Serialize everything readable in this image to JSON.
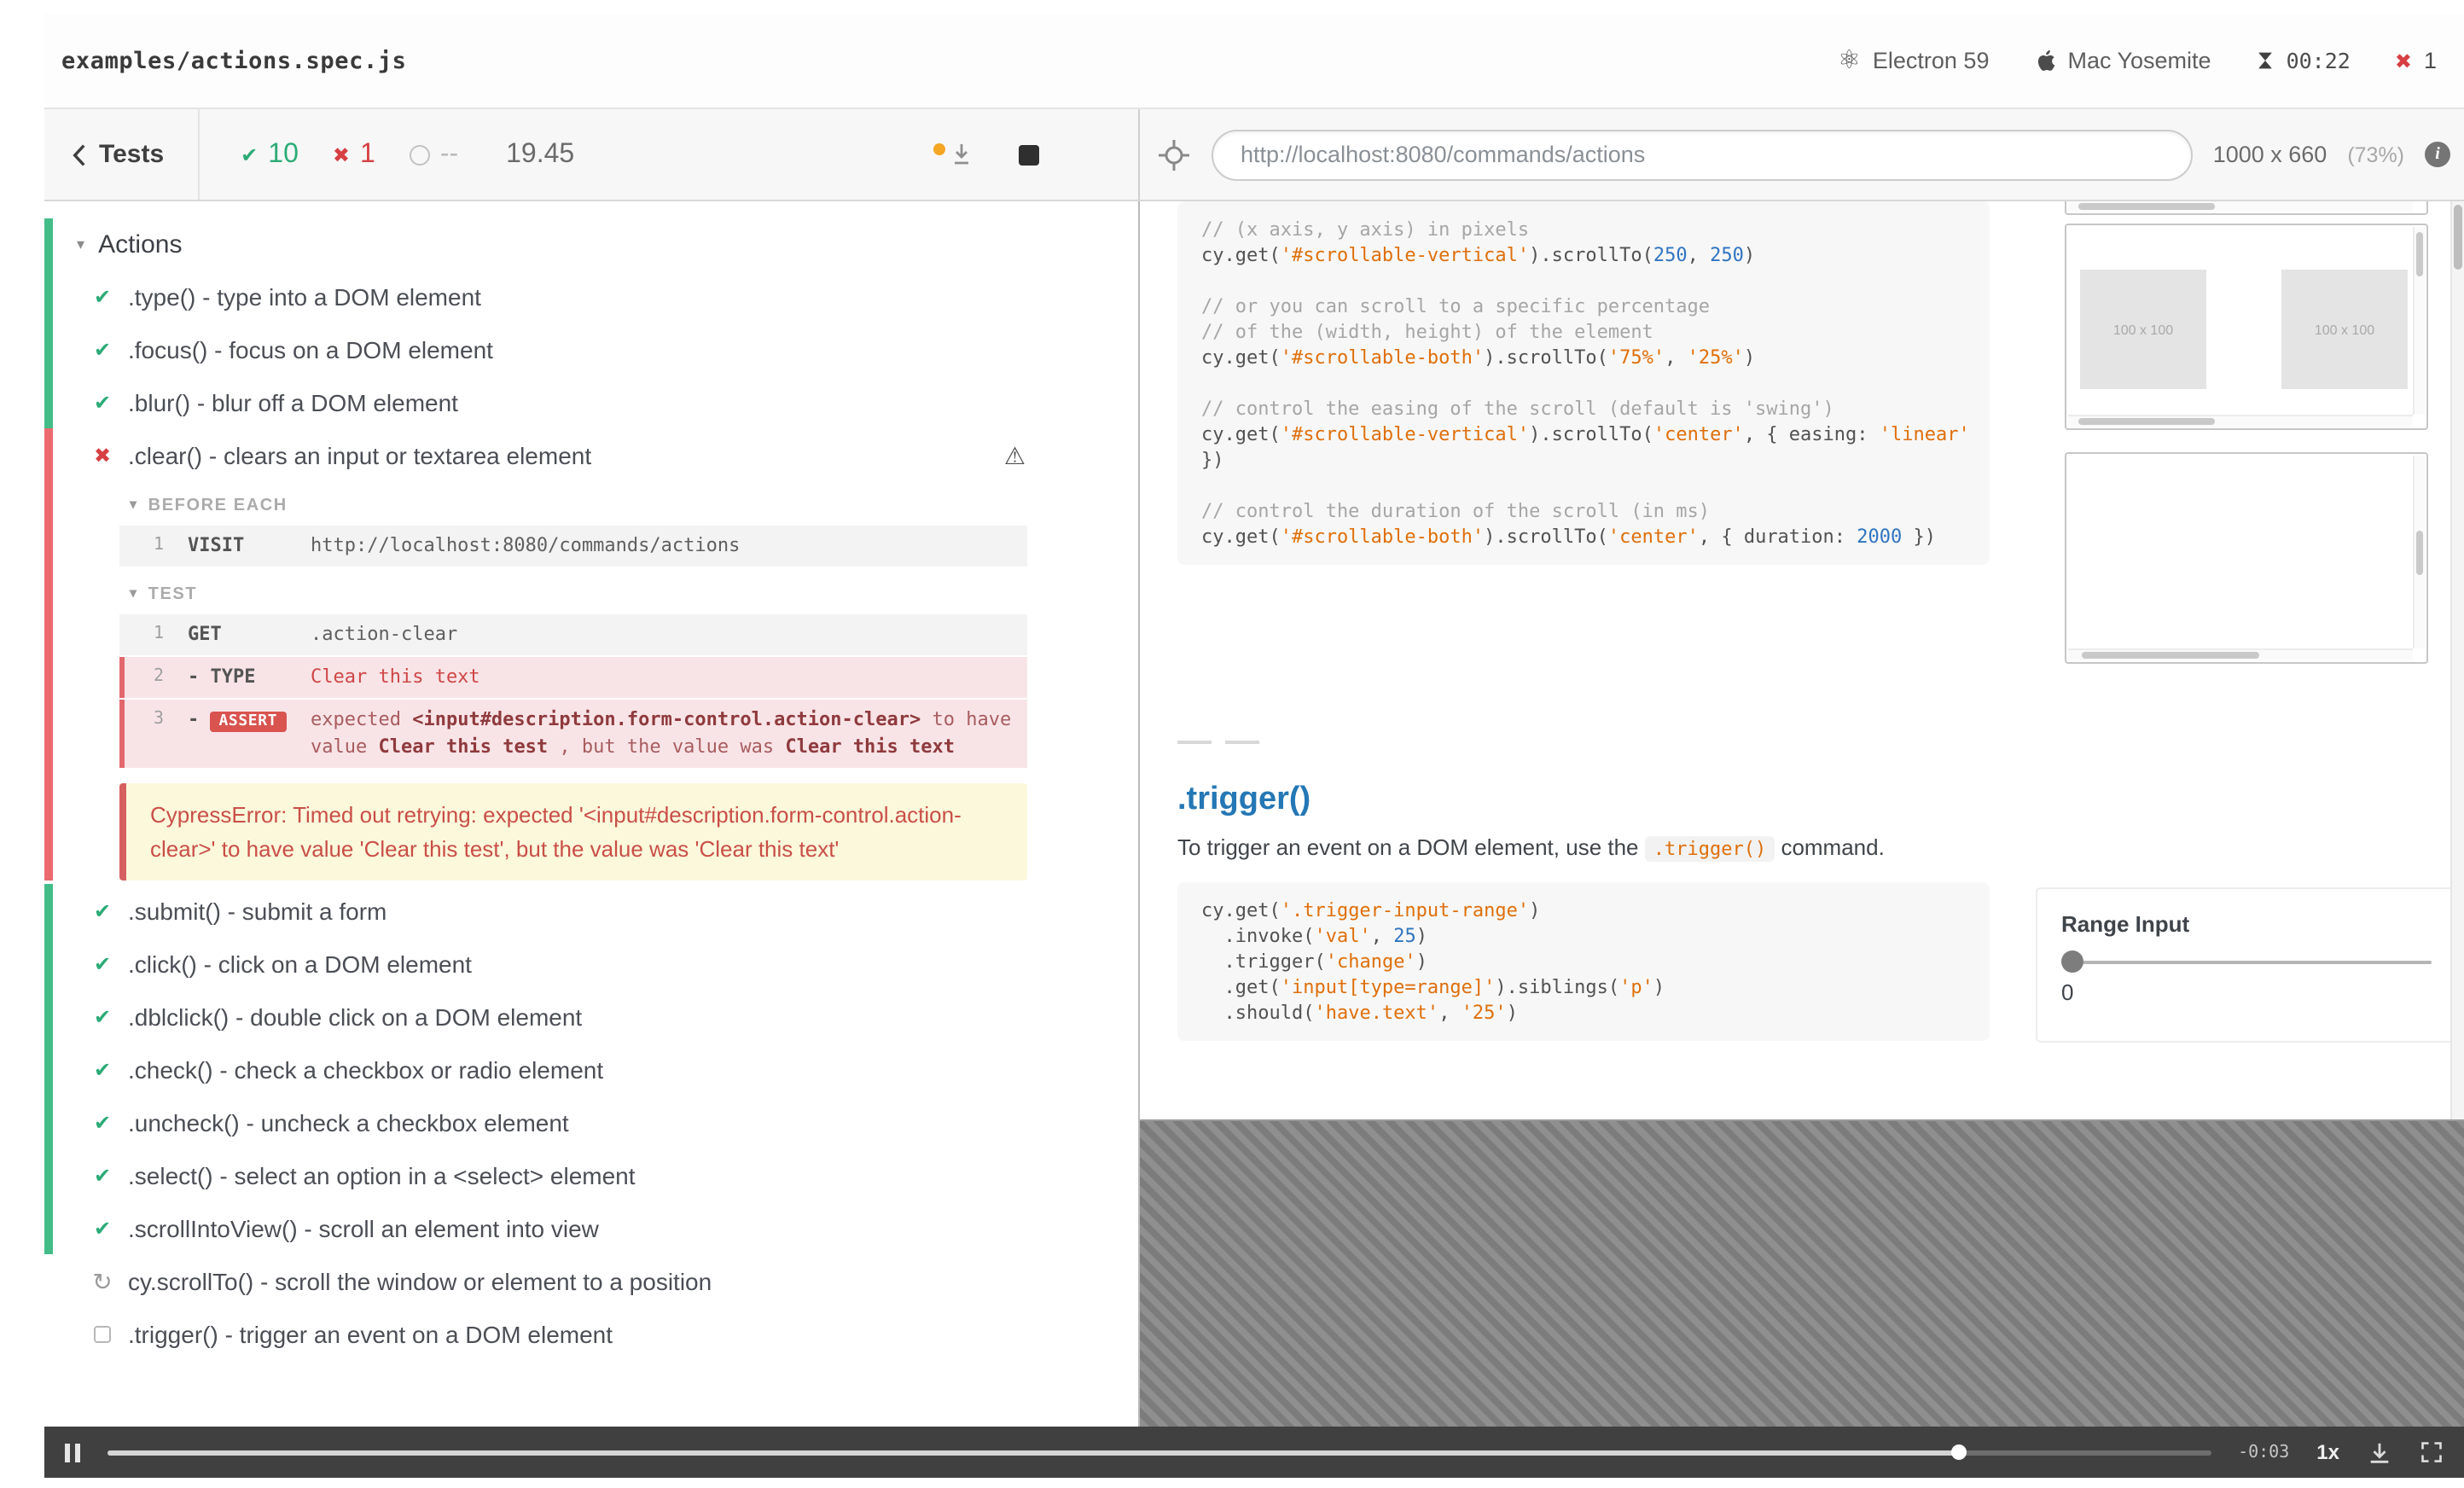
{
  "colors": {
    "pass_green": "#2cab76",
    "fail_red": "#d64043",
    "strip_green": "#43bd88",
    "strip_red": "#ea6a70",
    "error_box_bg": "#fcf8dc",
    "error_text": "#c94f46",
    "link_blue": "#2577b5",
    "code_string": "#df6f0b",
    "code_number": "#2f74c0",
    "autoscroll_dot": "#f5a623"
  },
  "icons": {
    "check": "✔",
    "cross": "✖",
    "caret": "▾",
    "warning": "⚠",
    "processing": "↻",
    "atom": "⚛"
  },
  "header": {
    "spec": "examples/actions.spec.js",
    "browser": "Electron 59",
    "os": "Mac Yosemite",
    "clock": "00:22",
    "failures": "1"
  },
  "toolbar": {
    "back": "Tests",
    "passed": "10",
    "failed": "1",
    "pending": "--",
    "duration": "19.45",
    "url": "http://localhost:8080/commands/actions",
    "viewport": "1000 x 660",
    "zoom": "(73%)"
  },
  "reporter": {
    "suite": "Actions",
    "tests_a": [
      {
        "label": ".type() - type into a DOM element"
      },
      {
        "label": ".focus() - focus on a DOM element"
      },
      {
        "label": ".blur() - blur off a DOM element"
      }
    ],
    "failed": {
      "label": ".clear() - clears an input or textarea element",
      "hook1": "BEFORE EACH",
      "visit": {
        "num": "1",
        "cmd": "VISIT",
        "msg": "http://localhost:8080/commands/actions"
      },
      "hook2": "TEST",
      "get": {
        "num": "1",
        "cmd": "GET",
        "msg": ".action-clear"
      },
      "type": {
        "num": "2",
        "cmd": "- TYPE",
        "msg": "Clear this text"
      },
      "assert": {
        "num": "3",
        "prefix": "- ",
        "cmd": "ASSERT",
        "p1": "expected ",
        "b1": "<input#description.form-control.action-clear>",
        "p2": " to have value ",
        "b2": "Clear this test",
        "p3": " , but the value was ",
        "b3": "Clear this text"
      },
      "error": "CypressError: Timed out retrying: expected '<input#description.form-control.action-clear>' to have value 'Clear this test', but the value was 'Clear this text'"
    },
    "tests_b": [
      {
        "label": ".submit() - submit a form"
      },
      {
        "label": ".click() - click on a DOM element"
      },
      {
        "label": ".dblclick() - double click on a DOM element"
      },
      {
        "label": ".check() - check a checkbox or radio element"
      },
      {
        "label": ".uncheck() - uncheck a checkbox element"
      },
      {
        "label": ".select() - select an option in a <select> element"
      },
      {
        "label": ".scrollIntoView() - scroll an element into view"
      }
    ],
    "processing_label": "cy.scrollTo() - scroll the window or element to a position",
    "pending_label": ".trigger() - trigger an event on a DOM element"
  },
  "aut": {
    "code1": [
      [
        {
          "c": "cm",
          "t": "// (x axis, y axis) in pixels"
        }
      ],
      [
        {
          "t": "cy.get("
        },
        {
          "c": "str",
          "t": "'#scrollable-vertical'"
        },
        {
          "t": ").scrollTo("
        },
        {
          "c": "num",
          "t": "250"
        },
        {
          "t": ", "
        },
        {
          "c": "num",
          "t": "250"
        },
        {
          "t": ")"
        }
      ],
      [],
      [
        {
          "c": "cm",
          "t": "// or you can scroll to a specific percentage"
        }
      ],
      [
        {
          "c": "cm",
          "t": "// of the (width, height) of the element"
        }
      ],
      [
        {
          "t": "cy.get("
        },
        {
          "c": "str",
          "t": "'#scrollable-both'"
        },
        {
          "t": ").scrollTo("
        },
        {
          "c": "str",
          "t": "'75%'"
        },
        {
          "t": ", "
        },
        {
          "c": "str",
          "t": "'25%'"
        },
        {
          "t": ")"
        }
      ],
      [],
      [
        {
          "c": "cm",
          "t": "// control the easing of the scroll (default is 'swing')"
        }
      ],
      [
        {
          "t": "cy.get("
        },
        {
          "c": "str",
          "t": "'#scrollable-vertical'"
        },
        {
          "t": ").scrollTo("
        },
        {
          "c": "str",
          "t": "'center'"
        },
        {
          "t": ", { easing: "
        },
        {
          "c": "str",
          "t": "'linear'"
        }
      ],
      [
        {
          "t": "})"
        }
      ],
      [],
      [
        {
          "c": "cm",
          "t": "// control the duration of the scroll (in ms)"
        }
      ],
      [
        {
          "t": "cy.get("
        },
        {
          "c": "str",
          "t": "'#scrollable-both'"
        },
        {
          "t": ").scrollTo("
        },
        {
          "c": "str",
          "t": "'center'"
        },
        {
          "t": ", { duration: "
        },
        {
          "c": "num",
          "t": "2000"
        },
        {
          "t": " })"
        }
      ]
    ],
    "box_label": "100 x 100",
    "trigger": {
      "heading": ".trigger()",
      "p1": "To trigger an event on a DOM element, use the ",
      "code": ".trigger()",
      "p2": " command."
    },
    "code2": [
      [
        {
          "t": "cy.get("
        },
        {
          "c": "str",
          "t": "'.trigger-input-range'"
        },
        {
          "t": ")"
        }
      ],
      [
        {
          "t": "  .invoke("
        },
        {
          "c": "str",
          "t": "'val'"
        },
        {
          "t": ", "
        },
        {
          "c": "num",
          "t": "25"
        },
        {
          "t": ")"
        }
      ],
      [
        {
          "t": "  .trigger("
        },
        {
          "c": "str",
          "t": "'change'"
        },
        {
          "t": ")"
        }
      ],
      [
        {
          "t": "  .get("
        },
        {
          "c": "str",
          "t": "'input[type=range]'"
        },
        {
          "t": ").siblings("
        },
        {
          "c": "str",
          "t": "'p'"
        },
        {
          "t": ")"
        }
      ],
      [
        {
          "t": "  .should("
        },
        {
          "c": "str",
          "t": "'have.text'"
        },
        {
          "t": ", "
        },
        {
          "c": "str",
          "t": "'25'"
        },
        {
          "t": ")"
        }
      ]
    ],
    "range": {
      "label": "Range Input",
      "value": "0"
    }
  },
  "controls": {
    "time": "-0:03",
    "rate": "1x"
  }
}
